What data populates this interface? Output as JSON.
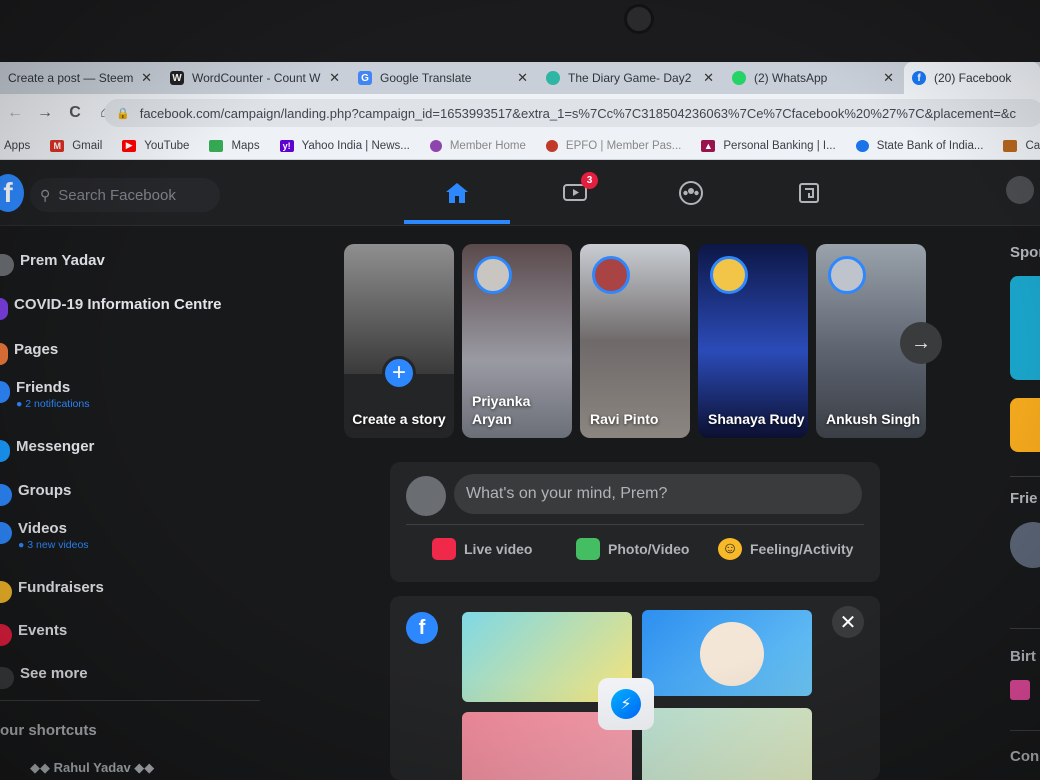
{
  "browser": {
    "tabs": [
      {
        "label": "Create a post — Steem",
        "favicon_color": "#ff7a00",
        "favicon_char": "",
        "close": "✕",
        "active": false
      },
      {
        "label": "WordCounter - Count W",
        "favicon_color": "#222222",
        "favicon_char": "W",
        "close": "✕",
        "active": false
      },
      {
        "label": "Google Translate",
        "favicon_color": "#4285f4",
        "favicon_char": "G",
        "close": "✕",
        "active": false
      },
      {
        "label": "The Diary Game- Day2",
        "favicon_color": "#2fb5a3",
        "favicon_char": "",
        "close": "✕",
        "active": false
      },
      {
        "label": "(2) WhatsApp",
        "favicon_color": "#25d366",
        "favicon_char": "",
        "close": "✕",
        "active": false
      },
      {
        "label": "(20) Facebook",
        "favicon_color": "#1877f2",
        "favicon_char": "f",
        "close": "",
        "active": true
      }
    ],
    "nav": {
      "back": "←",
      "forward": "→",
      "reload": "C",
      "home": "⌂"
    },
    "url": "facebook.com/campaign/landing.php?campaign_id=1653993517&extra_1=s%7Cc%7C318504236063%7Ce%7Cfacebook%20%27%7C&placement=&c",
    "lock_icon": "🔒",
    "bookmarks": [
      {
        "label": "Apps",
        "icon": "grid-icon",
        "color": "#4285f4"
      },
      {
        "label": "Gmail",
        "icon": "gmail-icon",
        "color": "#d93025"
      },
      {
        "label": "YouTube",
        "icon": "youtube-icon",
        "color": "#ff0000"
      },
      {
        "label": "Maps",
        "icon": "maps-icon",
        "color": "#34a853"
      },
      {
        "label": "Yahoo India | News...",
        "icon": "yahoo-icon",
        "color": "#5f01d1"
      },
      {
        "label": "Member Home",
        "icon": "globe-icon",
        "color": "#8e44ad"
      },
      {
        "label": "EPFO | Member Pas...",
        "icon": "epfo-icon",
        "color": "#c0392b"
      },
      {
        "label": "Personal Banking | I...",
        "icon": "axis-icon",
        "color": "#97144d"
      },
      {
        "label": "State Bank of India...",
        "icon": "sbi-icon",
        "color": "#1a73e8"
      },
      {
        "label": "Catal",
        "icon": "catal-icon",
        "color": "#b5651d"
      }
    ]
  },
  "facebook": {
    "logo": "f",
    "search_placeholder": "Search Facebook",
    "search_icon": "🔍",
    "nav_icons": [
      {
        "name": "home-icon",
        "glyph": "⌂",
        "active": true,
        "badge": ""
      },
      {
        "name": "watch-icon",
        "glyph": "▶",
        "active": false,
        "badge": "3"
      },
      {
        "name": "groups-icon",
        "glyph": "◎",
        "active": false,
        "badge": ""
      },
      {
        "name": "gaming-icon",
        "glyph": "▣",
        "active": false,
        "badge": ""
      }
    ],
    "left_nav": [
      {
        "label": "Prem Yadav",
        "sub": "",
        "color": "#6a6d72"
      },
      {
        "label": "COVID-19 Information Centre",
        "sub": "",
        "color": "#7b3fe4"
      },
      {
        "label": "Pages",
        "sub": "",
        "color": "#e8773a"
      },
      {
        "label": "Friends",
        "sub": "● 2 notifications",
        "color": "#2d88ff"
      },
      {
        "label": "Messenger",
        "sub": "",
        "color": "#1a9cff"
      },
      {
        "label": "Groups",
        "sub": "",
        "color": "#2d88ff"
      },
      {
        "label": "Videos",
        "sub": "● 3 new videos",
        "color": "#2d88ff"
      },
      {
        "label": "Fundraisers",
        "sub": "",
        "color": "#f7b928"
      },
      {
        "label": "Events",
        "sub": "",
        "color": "#e41e3f"
      },
      {
        "label": "See more",
        "sub": "",
        "color": "#3a3b3c"
      }
    ],
    "shortcuts_title": "our shortcuts",
    "shortcut_item": "◆◆ Rahul Yadav ◆◆",
    "stories": [
      {
        "name": "Create a story",
        "type": "create",
        "plus": "+"
      },
      {
        "name": "Priyanka Aryan",
        "type": "story",
        "bg": "#6d5f60"
      },
      {
        "name": "Ravi Pinto",
        "type": "story",
        "bg": "#8a8b92"
      },
      {
        "name": "Shanaya Rudy",
        "type": "story",
        "bg": "#1b2a6e"
      },
      {
        "name": "Ankush Singh",
        "type": "story",
        "bg": "#7a7f86"
      }
    ],
    "stories_next": "→",
    "composer": {
      "placeholder": "What's on your mind, Prem?",
      "actions": [
        {
          "label": "Live video",
          "icon": "live-video-icon",
          "glyph": "■",
          "color": "#f02849"
        },
        {
          "label": "Photo/Video",
          "icon": "photo-icon",
          "glyph": "▲",
          "color": "#45bd62"
        },
        {
          "label": "Feeling/Activity",
          "icon": "feeling-icon",
          "glyph": "☺",
          "color": "#f7b928"
        }
      ]
    },
    "rooms_card": {
      "fb_glyph": "f",
      "close_glyph": "✕",
      "messenger_glyph": "⚡"
    },
    "right_col": {
      "sponsored": "Spon",
      "friends": "Frie",
      "birthdays": "Birt",
      "contacts": "Con"
    }
  }
}
